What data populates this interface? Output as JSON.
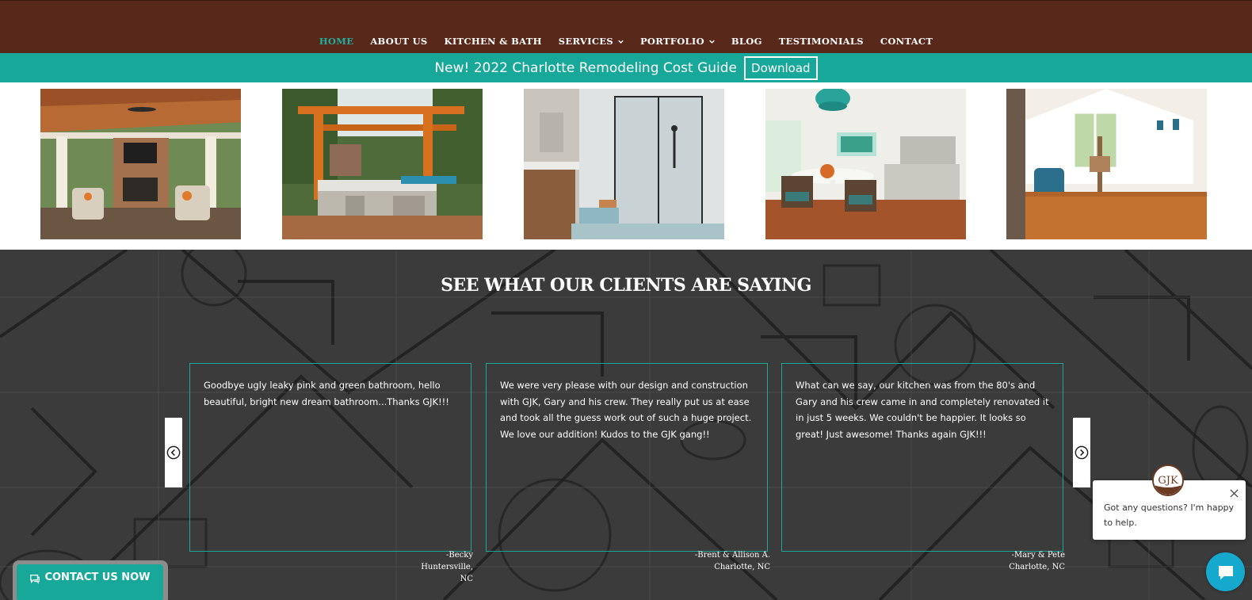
{
  "nav": {
    "items": [
      {
        "label": "HOME",
        "active": true,
        "has_dropdown": false
      },
      {
        "label": "ABOUT US",
        "active": false,
        "has_dropdown": false
      },
      {
        "label": "KITCHEN & BATH",
        "active": false,
        "has_dropdown": false
      },
      {
        "label": "SERVICES",
        "active": false,
        "has_dropdown": true
      },
      {
        "label": "PORTFOLIO",
        "active": false,
        "has_dropdown": true
      },
      {
        "label": "BLOG",
        "active": false,
        "has_dropdown": false
      },
      {
        "label": "TESTIMONIALS",
        "active": false,
        "has_dropdown": false
      },
      {
        "label": "CONTACT",
        "active": false,
        "has_dropdown": false
      }
    ]
  },
  "promo": {
    "text": "New! 2022 Charlotte Remodeling Cost Guide",
    "button_label": "Download"
  },
  "gallery": {
    "photos": [
      {
        "subject": "covered porch with fireplace"
      },
      {
        "subject": "pergola outdoor kitchen"
      },
      {
        "subject": "glass walk-in shower"
      },
      {
        "subject": "kitchen with dining table"
      },
      {
        "subject": "bright bonus room"
      }
    ]
  },
  "testimonials": {
    "title": "SEE WHAT OUR CLIENTS ARE SAYING",
    "cards": [
      {
        "text": "Goodbye ugly leaky pink and green bathroom, hello beautiful, bright new dream bathroom...Thanks GJK!!!",
        "author_line1": "-Becky",
        "author_line2": "Huntersville,",
        "author_line3": "NC"
      },
      {
        "text": "We were very please with our design and construction with GJK, Gary and his crew. They really put us at ease and took all the guess work out of such a huge project. We love our addition! Kudos to the GJK gang!!",
        "author_line1": "-Brent & Allison A.",
        "author_line2": "Charlotte, NC",
        "author_line3": ""
      },
      {
        "text": "What can we say, our kitchen was from the 80's and Gary and his crew came in and completely renovated it in just 5 weeks. We couldn't be happier. It looks so great! Just awesome! Thanks again GJK!!!",
        "author_line1": "-Mary & Pete",
        "author_line2": "Charlotte, NC",
        "author_line3": ""
      }
    ]
  },
  "contact_button": {
    "label": "CONTACT US NOW",
    "icon": "chat-icon"
  },
  "chat": {
    "message": "Got any questions? I'm happy to help.",
    "avatar_text": "GJK"
  },
  "colors": {
    "header_bg": "#58291a",
    "accent_teal": "#17a89a",
    "nav_active": "#20b0a0",
    "chat_blue": "#16a9ce"
  }
}
